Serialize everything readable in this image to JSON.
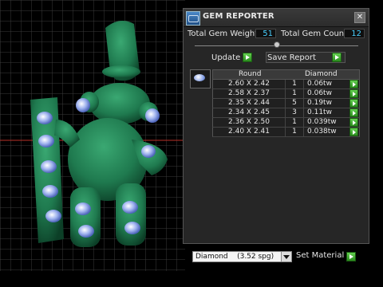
{
  "window": {
    "title": "GEM REPORTER",
    "icon": "gem-reporter-icon",
    "close_glyph": "✕"
  },
  "stats": {
    "total_gem_weight_label": "Total Gem Weight",
    "total_gem_weight_value": "51",
    "total_gem_count_label": "Total Gem Count",
    "total_gem_count_value": "12"
  },
  "actions": {
    "update_label": "Update",
    "save_report_label": "Save Report"
  },
  "table": {
    "headers": [
      "Round",
      "Diamond"
    ],
    "rows": [
      {
        "size": "2.60 X 2.42",
        "count": "1",
        "weight": "0.06tw"
      },
      {
        "size": "2.58 X 2.37",
        "count": "1",
        "weight": "0.06tw"
      },
      {
        "size": "2.35 X 2.44",
        "count": "5",
        "weight": "0.19tw"
      },
      {
        "size": "2.34 X 2.45",
        "count": "3",
        "weight": "0.11tw"
      },
      {
        "size": "2.36 X 2.50",
        "count": "1",
        "weight": "0.039tw"
      },
      {
        "size": "2.40 X 2.41",
        "count": "1",
        "weight": "0.038tw"
      }
    ]
  },
  "material": {
    "selected": "Diamond    (3.52 spg)",
    "set_label": "Set Material"
  },
  "colors": {
    "model_green": "#1f7a4f",
    "value_blue": "#4ad0ff",
    "go_green": "#3aa82a",
    "grid": "#3c3c3c",
    "axis_red": "#c0302a"
  }
}
